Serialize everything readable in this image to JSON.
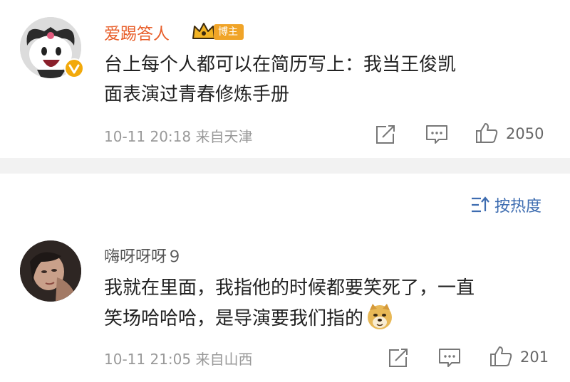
{
  "post": {
    "username": "爱踢答人",
    "badge": "博主",
    "content_line1": "台上每个人都可以在简历写上：我当王俊凯",
    "content_line2": "面表演过青春修炼手册",
    "meta": "10-11 20:18  来自天津",
    "likes": "2050"
  },
  "sort": {
    "label": "按热度",
    "icon": "sort-icon"
  },
  "comment": {
    "username": "嗨呀呀呀９",
    "content_line1": "我就在里面，我指他的时候都要笑死了，一直",
    "content_line2": "笑场哈哈哈，是导演要我们指的",
    "emoji": "doge-emoji",
    "meta": "10-11 21:05  来自山西",
    "likes": "201"
  },
  "icons": {
    "share": "share-icon",
    "comment": "comment-icon",
    "like": "like-icon"
  },
  "colors": {
    "username_orange": "#e8602c",
    "badge_gold": "#f0a428",
    "link_blue": "#3d6cb0",
    "meta_gray": "#999999"
  }
}
